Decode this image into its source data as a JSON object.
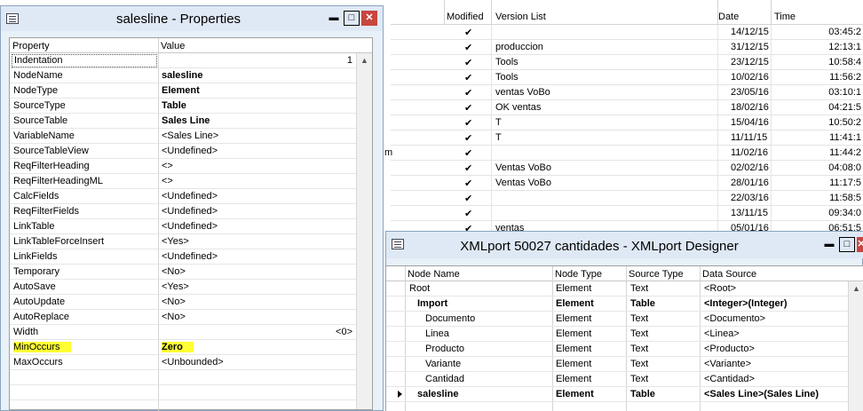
{
  "background_list": {
    "headers": {
      "modified": "Modified",
      "version_list": "Version List",
      "date": "Date",
      "time": "Time"
    },
    "rows": [
      {
        "modified": "✔",
        "version": "",
        "date": "14/12/15",
        "time": "03:45:2"
      },
      {
        "modified": "✔",
        "version": "produccion",
        "date": "31/12/15",
        "time": "12:13:1"
      },
      {
        "modified": "✔",
        "version": "Tools",
        "date": "23/12/15",
        "time": "10:58:4"
      },
      {
        "modified": "✔",
        "version": "Tools",
        "date": "10/02/16",
        "time": "11:56:2"
      },
      {
        "modified": "✔",
        "version": "ventas VoBo",
        "date": "23/05/16",
        "time": "03:10:1"
      },
      {
        "modified": "✔",
        "version": "OK ventas",
        "date": "18/02/16",
        "time": "04:21:5"
      },
      {
        "modified": "✔",
        "version": "T",
        "date": "15/04/16",
        "time": "10:50:2"
      },
      {
        "modified": "✔",
        "version": "T",
        "date": "11/11/15",
        "time": "11:41:1"
      },
      {
        "modified": "✔",
        "version": "",
        "date": "11/02/16",
        "time": "11:44:2"
      },
      {
        "modified": "✔",
        "version": "Ventas VoBo",
        "date": "02/02/16",
        "time": "04:08:0"
      },
      {
        "modified": "✔",
        "version": "Ventas VoBo",
        "date": "28/01/16",
        "time": "11:17:5"
      },
      {
        "modified": "✔",
        "version": "",
        "date": "22/03/16",
        "time": "11:58:5"
      },
      {
        "modified": "✔",
        "version": "",
        "date": "13/11/15",
        "time": "09:34:0"
      },
      {
        "modified": "✔",
        "version": "ventas",
        "date": "05/01/16",
        "time": "06:51:5"
      }
    ],
    "left_fragment": "m"
  },
  "properties_window": {
    "title": "salesline - Properties",
    "headers": {
      "property": "Property",
      "value": "Value"
    },
    "rows": [
      {
        "name": "Indentation",
        "value": "1"
      },
      {
        "name": "NodeName",
        "value": "salesline"
      },
      {
        "name": "NodeType",
        "value": "Element"
      },
      {
        "name": "SourceType",
        "value": "Table"
      },
      {
        "name": "SourceTable",
        "value": "Sales Line"
      },
      {
        "name": "VariableName",
        "value": "<Sales Line>"
      },
      {
        "name": "SourceTableView",
        "value": "<Undefined>"
      },
      {
        "name": "ReqFilterHeading",
        "value": "<>"
      },
      {
        "name": "ReqFilterHeadingML",
        "value": "<>"
      },
      {
        "name": "CalcFields",
        "value": "<Undefined>"
      },
      {
        "name": "ReqFilterFields",
        "value": "<Undefined>"
      },
      {
        "name": "LinkTable",
        "value": "<Undefined>"
      },
      {
        "name": "LinkTableForceInsert",
        "value": "<Yes>"
      },
      {
        "name": "LinkFields",
        "value": "<Undefined>"
      },
      {
        "name": "Temporary",
        "value": "<No>"
      },
      {
        "name": "AutoSave",
        "value": "<Yes>"
      },
      {
        "name": "AutoUpdate",
        "value": "<No>"
      },
      {
        "name": "AutoReplace",
        "value": "<No>"
      },
      {
        "name": "Width",
        "value": "<0>"
      },
      {
        "name": "MinOccurs",
        "value": "Zero"
      },
      {
        "name": "MaxOccurs",
        "value": "<Unbounded>"
      }
    ],
    "highlight_color": "#ffff33"
  },
  "xmlport_window": {
    "title": "XMLport 50027 cantidades - XMLport Designer",
    "headers": {
      "node_name": "Node Name",
      "node_type": "Node Type",
      "source_type": "Source Type",
      "data_source": "Data Source"
    },
    "rows": [
      {
        "name": "Root",
        "type": "Element",
        "source": "Text",
        "data": "<Root>"
      },
      {
        "name": "Import",
        "type": "Element",
        "source": "Table",
        "data": "<Integer>(Integer)"
      },
      {
        "name": "Documento",
        "type": "Element",
        "source": "Text",
        "data": "<Documento>"
      },
      {
        "name": "Linea",
        "type": "Element",
        "source": "Text",
        "data": "<Linea>"
      },
      {
        "name": "Producto",
        "type": "Element",
        "source": "Text",
        "data": "<Producto>"
      },
      {
        "name": "Variante",
        "type": "Element",
        "source": "Text",
        "data": "<Variante>"
      },
      {
        "name": "Cantidad",
        "type": "Element",
        "source": "Text",
        "data": "<Cantidad>"
      },
      {
        "name": "salesline",
        "type": "Element",
        "source": "Table",
        "data": "<Sales Line>(Sales Line)"
      }
    ]
  },
  "window_buttons": {
    "minimize": "▬",
    "maximize": "□",
    "close": "✕"
  },
  "colors": {
    "title_bar": "#dfe9f5",
    "close_button": "#c7463e",
    "frame": "#e8f0f8"
  }
}
